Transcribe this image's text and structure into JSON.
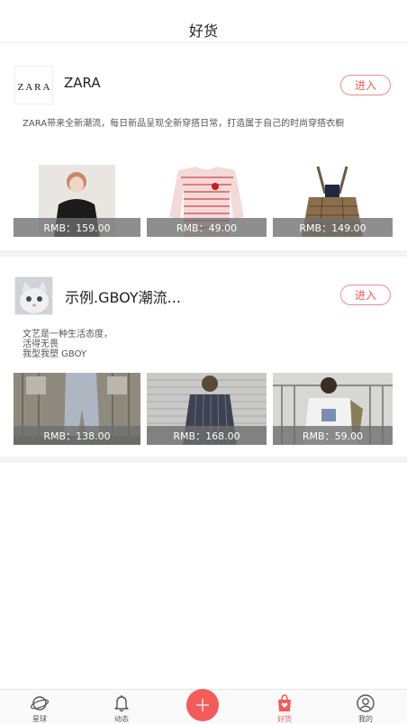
{
  "header": {
    "title": "好货"
  },
  "stores": [
    {
      "name": "ZARA",
      "logo_text": "ZARA",
      "enter_label": "进入",
      "description": [
        "ZARA带来全新潮流，每日新品呈现全新穿搭日常，打造属于自己的时尚穿搭衣橱"
      ],
      "products": [
        {
          "price": "RMB：159.00"
        },
        {
          "price": "RMB：49.00"
        },
        {
          "price": "RMB：149.00"
        }
      ]
    },
    {
      "name": "示例.GBOY潮流...",
      "enter_label": "进入",
      "description": [
        "文艺是一种生活态度，",
        "活得无畏",
        "我型我塑  GBOY"
      ],
      "products": [
        {
          "price": "RMB：138.00"
        },
        {
          "price": "RMB：168.00"
        },
        {
          "price": "RMB：59.00"
        }
      ]
    }
  ],
  "tabbar": {
    "items": [
      {
        "label": "星球",
        "icon": "planet-icon"
      },
      {
        "label": "动态",
        "icon": "bell-icon"
      },
      {
        "label": "",
        "icon": "plus-icon"
      },
      {
        "label": "好货",
        "icon": "bag-icon",
        "active": true
      },
      {
        "label": "我的",
        "icon": "user-icon"
      }
    ]
  },
  "colors": {
    "accent": "#f45b5b",
    "price_overlay": "#6e6e6e"
  }
}
